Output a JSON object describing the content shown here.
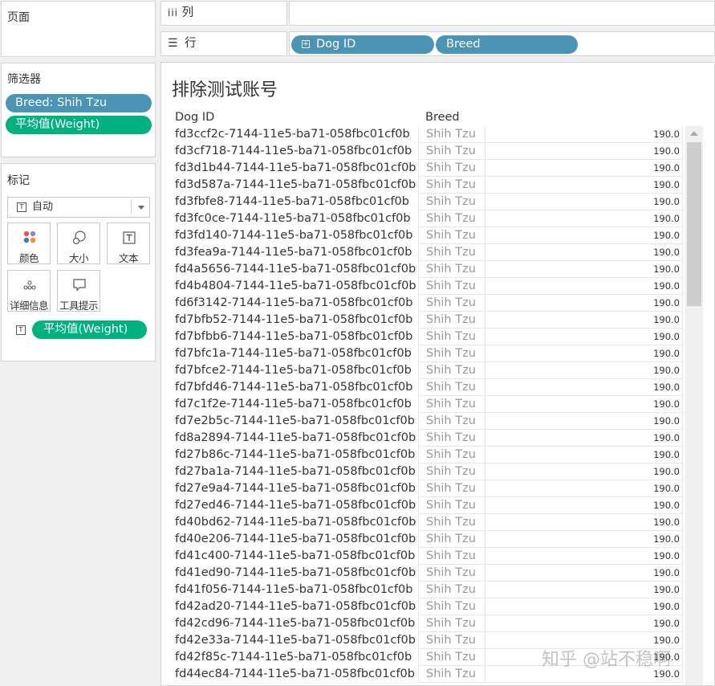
{
  "left_panel": {
    "pages_title": "页面",
    "filters_title": "筛选器",
    "filters": [
      {
        "label": "Breed: Shih Tzu",
        "color": "#4a94b5"
      },
      {
        "label": "平均值(Weight)",
        "color": "#00b180"
      }
    ],
    "marks_title": "标记",
    "mark_type": "自动",
    "mark_buttons": [
      {
        "label": "颜色",
        "icon": "color-dots-icon"
      },
      {
        "label": "大小",
        "icon": "size-circles-icon"
      },
      {
        "label": "文本",
        "icon": "text-t-icon"
      },
      {
        "label": "详细信息",
        "icon": "detail-dots-icon"
      },
      {
        "label": "工具提示",
        "icon": "tooltip-bubble-icon"
      }
    ],
    "mark_field": "平均值(Weight)"
  },
  "shelves": {
    "columns_label": "列",
    "rows_label": "行",
    "row_pills": [
      "Dog ID",
      "Breed"
    ]
  },
  "view": {
    "title": "排除测试账号",
    "headers": [
      "Dog ID",
      "Breed"
    ],
    "rows": [
      {
        "id": "fd3ccf2c-7144-11e5-ba71-058fbc01cf0b",
        "breed": "Shih Tzu",
        "value": "190.0"
      },
      {
        "id": "fd3cf718-7144-11e5-ba71-058fbc01cf0b",
        "breed": "Shih Tzu",
        "value": "190.0"
      },
      {
        "id": "fd3d1b44-7144-11e5-ba71-058fbc01cf0b",
        "breed": "Shih Tzu",
        "value": "190.0"
      },
      {
        "id": "fd3d587a-7144-11e5-ba71-058fbc01cf0b",
        "breed": "Shih Tzu",
        "value": "190.0"
      },
      {
        "id": "fd3fbfe8-7144-11e5-ba71-058fbc01cf0b",
        "breed": "Shih Tzu",
        "value": "190.0"
      },
      {
        "id": "fd3fc0ce-7144-11e5-ba71-058fbc01cf0b",
        "breed": "Shih Tzu",
        "value": "190.0"
      },
      {
        "id": "fd3fd140-7144-11e5-ba71-058fbc01cf0b",
        "breed": "Shih Tzu",
        "value": "190.0"
      },
      {
        "id": "fd3fea9a-7144-11e5-ba71-058fbc01cf0b",
        "breed": "Shih Tzu",
        "value": "190.0"
      },
      {
        "id": "fd4a5656-7144-11e5-ba71-058fbc01cf0b",
        "breed": "Shih Tzu",
        "value": "190.0"
      },
      {
        "id": "fd4b4804-7144-11e5-ba71-058fbc01cf0b",
        "breed": "Shih Tzu",
        "value": "190.0"
      },
      {
        "id": "fd6f3142-7144-11e5-ba71-058fbc01cf0b",
        "breed": "Shih Tzu",
        "value": "190.0"
      },
      {
        "id": "fd7bfb52-7144-11e5-ba71-058fbc01cf0b",
        "breed": "Shih Tzu",
        "value": "190.0"
      },
      {
        "id": "fd7bfbb6-7144-11e5-ba71-058fbc01cf0b",
        "breed": "Shih Tzu",
        "value": "190.0"
      },
      {
        "id": "fd7bfc1a-7144-11e5-ba71-058fbc01cf0b",
        "breed": "Shih Tzu",
        "value": "190.0"
      },
      {
        "id": "fd7bfce2-7144-11e5-ba71-058fbc01cf0b",
        "breed": "Shih Tzu",
        "value": "190.0"
      },
      {
        "id": "fd7bfd46-7144-11e5-ba71-058fbc01cf0b",
        "breed": "Shih Tzu",
        "value": "190.0"
      },
      {
        "id": "fd7c1f2e-7144-11e5-ba71-058fbc01cf0b",
        "breed": "Shih Tzu",
        "value": "190.0"
      },
      {
        "id": "fd7e2b5c-7144-11e5-ba71-058fbc01cf0b",
        "breed": "Shih Tzu",
        "value": "190.0"
      },
      {
        "id": "fd8a2894-7144-11e5-ba71-058fbc01cf0b",
        "breed": "Shih Tzu",
        "value": "190.0"
      },
      {
        "id": "fd27b86c-7144-11e5-ba71-058fbc01cf0b",
        "breed": "Shih Tzu",
        "value": "190.0"
      },
      {
        "id": "fd27ba1a-7144-11e5-ba71-058fbc01cf0b",
        "breed": "Shih Tzu",
        "value": "190.0"
      },
      {
        "id": "fd27e9a4-7144-11e5-ba71-058fbc01cf0b",
        "breed": "Shih Tzu",
        "value": "190.0"
      },
      {
        "id": "fd27ed46-7144-11e5-ba71-058fbc01cf0b",
        "breed": "Shih Tzu",
        "value": "190.0"
      },
      {
        "id": "fd40bd62-7144-11e5-ba71-058fbc01cf0b",
        "breed": "Shih Tzu",
        "value": "190.0"
      },
      {
        "id": "fd40e206-7144-11e5-ba71-058fbc01cf0b",
        "breed": "Shih Tzu",
        "value": "190.0"
      },
      {
        "id": "fd41c400-7144-11e5-ba71-058fbc01cf0b",
        "breed": "Shih Tzu",
        "value": "190.0"
      },
      {
        "id": "fd41ed90-7144-11e5-ba71-058fbc01cf0b",
        "breed": "Shih Tzu",
        "value": "190.0"
      },
      {
        "id": "fd41f056-7144-11e5-ba71-058fbc01cf0b",
        "breed": "Shih Tzu",
        "value": "190.0"
      },
      {
        "id": "fd42ad20-7144-11e5-ba71-058fbc01cf0b",
        "breed": "Shih Tzu",
        "value": "190.0"
      },
      {
        "id": "fd42cd96-7144-11e5-ba71-058fbc01cf0b",
        "breed": "Shih Tzu",
        "value": "190.0"
      },
      {
        "id": "fd42e33a-7144-11e5-ba71-058fbc01cf0b",
        "breed": "Shih Tzu",
        "value": "190.0"
      },
      {
        "id": "fd42f85c-7144-11e5-ba71-058fbc01cf0b",
        "breed": "Shih Tzu",
        "value": "190.0"
      },
      {
        "id": "fd44ec84-7144-11e5-ba71-058fbc01cf0b",
        "breed": "Shih Tzu",
        "value": "190.0"
      }
    ]
  },
  "watermark": "知乎 @站不稳啊"
}
